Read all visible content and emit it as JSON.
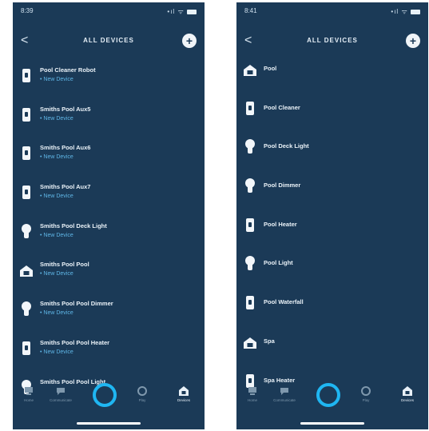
{
  "screens": [
    {
      "status": {
        "time": "8:39",
        "signal": "•ıl",
        "wifi": "ᯤ"
      },
      "nav": {
        "back": "<",
        "title": "ALL DEVICES",
        "add": "+"
      },
      "devices": [
        {
          "icon": "plug",
          "name": "Pool Cleaner Robot",
          "subtitle": "• New Device"
        },
        {
          "icon": "plug",
          "name": "Smiths Pool Aux5",
          "subtitle": "• New Device"
        },
        {
          "icon": "plug",
          "name": "Smiths Pool Aux6",
          "subtitle": "• New Device"
        },
        {
          "icon": "plug",
          "name": "Smiths Pool Aux7",
          "subtitle": "• New Device"
        },
        {
          "icon": "bulb",
          "name": "Smiths Pool Deck Light",
          "subtitle": "• New Device"
        },
        {
          "icon": "home",
          "name": "Smiths Pool Pool",
          "subtitle": "• New Device"
        },
        {
          "icon": "bulb",
          "name": "Smiths Pool Pool Dimmer",
          "subtitle": "• New Device"
        },
        {
          "icon": "plug",
          "name": "Smiths Pool Pool Heater",
          "subtitle": "• New Device"
        },
        {
          "icon": "bulb",
          "name": "Smiths Pool Pool Light",
          "subtitle": ""
        }
      ],
      "tabs": [
        "Home",
        "Communicate",
        "Alexa",
        "Play",
        "Devices"
      ]
    },
    {
      "status": {
        "time": "8:41",
        "signal": "•ıl",
        "wifi": "ᯤ"
      },
      "nav": {
        "back": "<",
        "title": "ALL DEVICES",
        "add": "+"
      },
      "devices": [
        {
          "icon": "home",
          "name": "Pool",
          "subtitle": ""
        },
        {
          "icon": "plug",
          "name": "Pool Cleaner",
          "subtitle": ""
        },
        {
          "icon": "bulb",
          "name": "Pool Deck Light",
          "subtitle": ""
        },
        {
          "icon": "bulb",
          "name": "Pool Dimmer",
          "subtitle": ""
        },
        {
          "icon": "plug",
          "name": "Pool Heater",
          "subtitle": ""
        },
        {
          "icon": "bulb",
          "name": "Pool Light",
          "subtitle": ""
        },
        {
          "icon": "plug",
          "name": "Pool Waterfall",
          "subtitle": ""
        },
        {
          "icon": "home",
          "name": "Spa",
          "subtitle": ""
        },
        {
          "icon": "plug",
          "name": "Spa Heater",
          "subtitle": ""
        }
      ],
      "tabs": [
        "Home",
        "Communicate",
        "Alexa",
        "Play",
        "Devices"
      ]
    }
  ],
  "colors": {
    "background": "#1b3a57",
    "accent": "#1fb6f2",
    "subtitle": "#5fb6e6",
    "icon": "#f2f6fa"
  }
}
